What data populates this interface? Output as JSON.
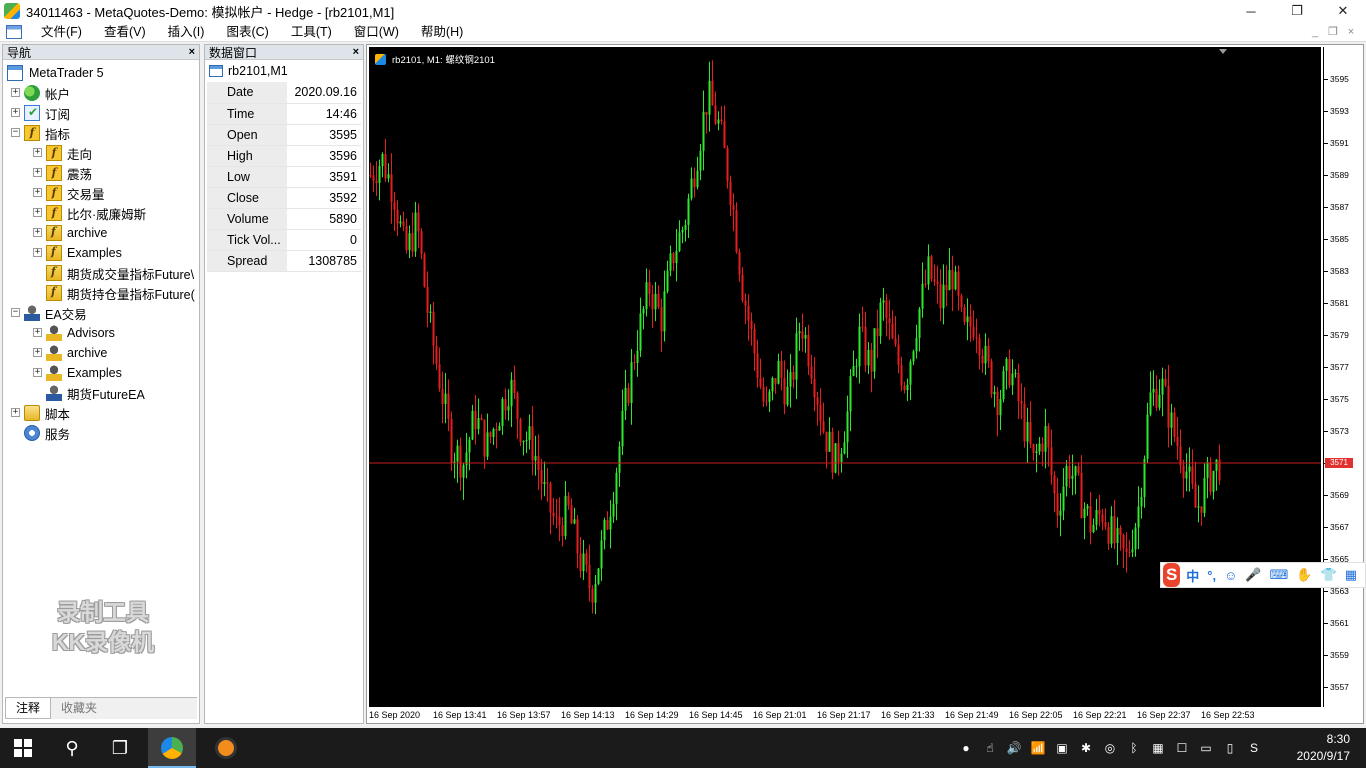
{
  "window": {
    "title": "34011463 - MetaQuotes-Demo: 模拟帐户 - Hedge - [rb2101,M1]",
    "controls": [
      "─",
      "❐",
      "✕"
    ]
  },
  "menu": {
    "items": [
      "文件(F)",
      "查看(V)",
      "插入(I)",
      "图表(C)",
      "工具(T)",
      "窗口(W)",
      "帮助(H)"
    ],
    "mdi_controls": [
      "_",
      "❐",
      "×"
    ]
  },
  "navigator": {
    "title": "导航",
    "close": "×",
    "tree": [
      {
        "label": "MetaTrader 5",
        "level": 0,
        "icon": "mt5-icon",
        "expander": ""
      },
      {
        "label": "帐户",
        "level": 1,
        "icon": "accounts-icon",
        "expander": "+"
      },
      {
        "label": "订阅",
        "level": 1,
        "icon": "subscriptions-icon",
        "expander": "+"
      },
      {
        "label": "指标",
        "level": 1,
        "icon": "indicators-icon",
        "expander": "−"
      },
      {
        "label": "走向",
        "level": 2,
        "icon": "indicator-group-icon",
        "expander": "+"
      },
      {
        "label": "震荡",
        "level": 2,
        "icon": "indicator-group-icon",
        "expander": "+"
      },
      {
        "label": "交易量",
        "level": 2,
        "icon": "indicator-group-icon",
        "expander": "+"
      },
      {
        "label": "比尔·威廉姆斯",
        "level": 2,
        "icon": "indicator-group-icon",
        "expander": "+"
      },
      {
        "label": "archive",
        "level": 2,
        "icon": "indicator-folder-icon",
        "expander": "+"
      },
      {
        "label": "Examples",
        "level": 2,
        "icon": "indicator-folder-icon",
        "expander": "+"
      },
      {
        "label": "期货成交量指标Future\\",
        "level": 2,
        "icon": "indicator-folder-icon",
        "expander": ""
      },
      {
        "label": "期货持仓量指标Future(",
        "level": 2,
        "icon": "indicator-folder-icon",
        "expander": ""
      },
      {
        "label": "EA交易",
        "level": 1,
        "icon": "expert-advisors-icon",
        "expander": "−"
      },
      {
        "label": "Advisors",
        "level": 2,
        "icon": "ea-folder-icon",
        "expander": "+"
      },
      {
        "label": "archive",
        "level": 2,
        "icon": "ea-folder-icon",
        "expander": "+"
      },
      {
        "label": "Examples",
        "level": 2,
        "icon": "ea-folder-icon",
        "expander": "+"
      },
      {
        "label": "期货FutureEA",
        "level": 2,
        "icon": "expert-advisor-icon",
        "expander": ""
      },
      {
        "label": "脚本",
        "level": 1,
        "icon": "scripts-icon",
        "expander": "+"
      },
      {
        "label": "服务",
        "level": 1,
        "icon": "services-icon",
        "expander": ""
      }
    ],
    "tabs": [
      "注释",
      "收藏夹"
    ],
    "watermark": [
      "录制工具",
      "KK录像机"
    ]
  },
  "data_window": {
    "title": "数据窗口",
    "close": "×",
    "symbol": "rb2101,M1",
    "rows": [
      {
        "key": "Date",
        "value": "2020.09.16"
      },
      {
        "key": "Time",
        "value": "14:46"
      },
      {
        "key": "Open",
        "value": "3595"
      },
      {
        "key": "High",
        "value": "3596"
      },
      {
        "key": "Low",
        "value": "3591"
      },
      {
        "key": "Close",
        "value": "3592"
      },
      {
        "key": "Volume",
        "value": "5890"
      },
      {
        "key": "Tick Vol...",
        "value": "0"
      },
      {
        "key": "Spread",
        "value": "1308785"
      }
    ]
  },
  "chart": {
    "label": "rb2101, M1:  螺纹钢2101",
    "current_price_label": "3571",
    "colors": {
      "bull": "#2ee82e",
      "bear": "#e81e1e",
      "background": "#000000",
      "price_line": "#c81e1e"
    }
  },
  "chart_data": {
    "type": "candlestick",
    "symbol": "rb2101",
    "timeframe": "M1",
    "ylim": [
      3556,
      3596
    ],
    "y_ticks": [
      3557,
      3559,
      3561,
      3563,
      3565,
      3567,
      3569,
      3571,
      3573,
      3575,
      3577,
      3579,
      3581,
      3583,
      3585,
      3587,
      3589,
      3591,
      3593,
      3595
    ],
    "current_price": 3571,
    "x_ticks": [
      "16 Sep 2020",
      "16 Sep 13:41",
      "16 Sep 13:57",
      "16 Sep 14:13",
      "16 Sep 14:29",
      "16 Sep 14:45",
      "16 Sep 21:01",
      "16 Sep 21:17",
      "16 Sep 21:33",
      "16 Sep 21:49",
      "16 Sep 22:05",
      "16 Sep 22:21",
      "16 Sep 22:37",
      "16 Sep 22:53"
    ],
    "close_path": [
      3589,
      3590,
      3588,
      3584,
      3586,
      3580,
      3576,
      3572,
      3571,
      3574,
      3572,
      3574,
      3576,
      3573,
      3572,
      3569,
      3567,
      3568,
      3565,
      3563,
      3566,
      3570,
      3575,
      3579,
      3582,
      3580,
      3584,
      3586,
      3590,
      3594,
      3592,
      3588,
      3582,
      3578,
      3574,
      3577,
      3575,
      3580,
      3577,
      3573,
      3571,
      3574,
      3579,
      3577,
      3581,
      3578,
      3576,
      3580,
      3583,
      3581,
      3583,
      3579,
      3580,
      3577,
      3575,
      3577,
      3574,
      3571,
      3573,
      3568,
      3571,
      3569,
      3567,
      3568,
      3566,
      3565,
      3568,
      3575,
      3576,
      3573,
      3571,
      3568,
      3570,
      3571
    ]
  },
  "ime": {
    "logo": "S",
    "items": [
      "中",
      "°,",
      "☺",
      "🎤",
      "⌨",
      "✋",
      "👕",
      "▦"
    ]
  },
  "taskbar": {
    "time": "8:30",
    "date": "2020/9/17",
    "tray": [
      "●",
      "☝",
      "🔊",
      "📶",
      "▣",
      "✱",
      "◎",
      "ᛒ",
      "▦",
      "☐",
      "▭",
      "▯",
      "S"
    ]
  }
}
